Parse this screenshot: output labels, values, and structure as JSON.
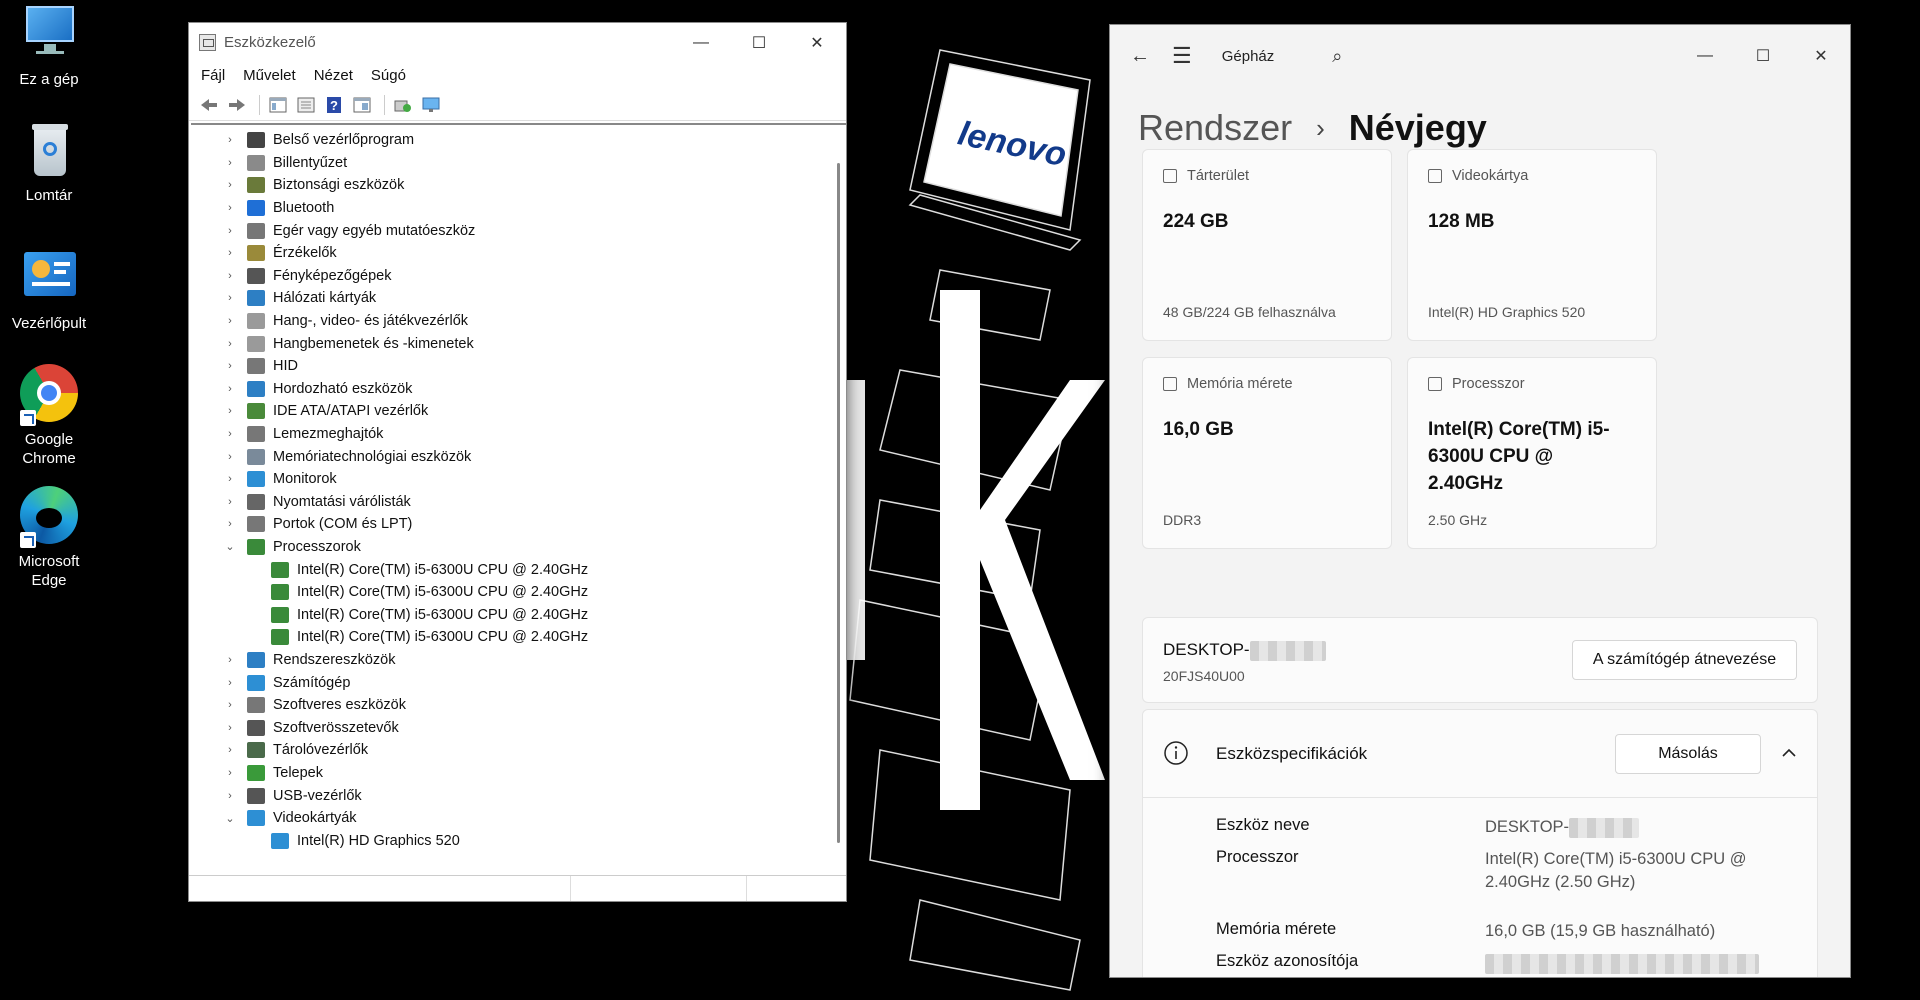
{
  "desktop": {
    "icons": [
      {
        "label": "Ez a gép",
        "icon": "monitor-icon"
      },
      {
        "label": "Lomtár",
        "icon": "recycle-bin-icon"
      },
      {
        "label": "Vezérlőpult",
        "icon": "control-panel-icon"
      },
      {
        "label_line1": "Google",
        "label_line2": "Chrome",
        "icon": "chrome-icon"
      },
      {
        "label_line1": "Microsoft",
        "label_line2": "Edge",
        "icon": "edge-icon"
      }
    ],
    "wallpaper_text": "lenovo"
  },
  "devmgr": {
    "title": "Eszközkezelő",
    "menu": [
      "Fájl",
      "Művelet",
      "Nézet",
      "Súgó"
    ],
    "tree": [
      {
        "label": "Belső vezérlőprogram",
        "expanded": false,
        "color": "#444444"
      },
      {
        "label": "Billentyűzet",
        "expanded": false,
        "color": "#8a8a8a"
      },
      {
        "label": "Biztonsági eszközök",
        "expanded": false,
        "color": "#6a7a3a"
      },
      {
        "label": "Bluetooth",
        "expanded": false,
        "color": "#1f6fd6"
      },
      {
        "label": "Egér vagy egyéb mutatóeszköz",
        "expanded": false,
        "color": "#777777"
      },
      {
        "label": "Érzékelők",
        "expanded": false,
        "color": "#9a8a3a"
      },
      {
        "label": "Fényképezőgépek",
        "expanded": false,
        "color": "#555555"
      },
      {
        "label": "Hálózati kártyák",
        "expanded": false,
        "color": "#2d7fc4"
      },
      {
        "label": "Hang-, video- és játékvezérlők",
        "expanded": false,
        "color": "#9a9a9a"
      },
      {
        "label": "Hangbemenetek és -kimenetek",
        "expanded": false,
        "color": "#9a9a9a"
      },
      {
        "label": "HID",
        "expanded": false,
        "color": "#777777"
      },
      {
        "label": "Hordozható eszközök",
        "expanded": false,
        "color": "#2d7fc4"
      },
      {
        "label": "IDE ATA/ATAPI vezérlők",
        "expanded": false,
        "color": "#4a8a3a"
      },
      {
        "label": "Lemezmeghajtók",
        "expanded": false,
        "color": "#777777"
      },
      {
        "label": "Memóriatechnológiai eszközök",
        "expanded": false,
        "color": "#7a8a9a"
      },
      {
        "label": "Monitorok",
        "expanded": false,
        "color": "#2d8fd4"
      },
      {
        "label": "Nyomtatási várólisták",
        "expanded": false,
        "color": "#666666"
      },
      {
        "label": "Portok (COM és LPT)",
        "expanded": false,
        "color": "#777777"
      },
      {
        "label": "Processzorok",
        "expanded": true,
        "color": "#3a8a3a"
      },
      {
        "label": "Intel(R) Core(TM) i5-6300U CPU @ 2.40GHz",
        "child": true,
        "color": "#3a8a3a"
      },
      {
        "label": "Intel(R) Core(TM) i5-6300U CPU @ 2.40GHz",
        "child": true,
        "color": "#3a8a3a"
      },
      {
        "label": "Intel(R) Core(TM) i5-6300U CPU @ 2.40GHz",
        "child": true,
        "color": "#3a8a3a"
      },
      {
        "label": "Intel(R) Core(TM) i5-6300U CPU @ 2.40GHz",
        "child": true,
        "color": "#3a8a3a"
      },
      {
        "label": "Rendszereszközök",
        "expanded": false,
        "color": "#2d7fc4"
      },
      {
        "label": "Számítógép",
        "expanded": false,
        "color": "#2d8fd4"
      },
      {
        "label": "Szoftveres eszközök",
        "expanded": false,
        "color": "#777777"
      },
      {
        "label": "Szoftverösszetevők",
        "expanded": false,
        "color": "#555555"
      },
      {
        "label": "Tárolóvezérlők",
        "expanded": false,
        "color": "#4a6a4a"
      },
      {
        "label": "Telepek",
        "expanded": false,
        "color": "#3a9a3a"
      },
      {
        "label": "USB-vezérlők",
        "expanded": false,
        "color": "#555555"
      },
      {
        "label": "Videokártyák",
        "expanded": true,
        "color": "#2d8fd4"
      },
      {
        "label": "Intel(R) HD Graphics 520",
        "child": true,
        "color": "#2d8fd4"
      }
    ]
  },
  "settings": {
    "app_title": "Gépház",
    "breadcrumb_parent": "Rendszer",
    "breadcrumb_current": "Névjegy",
    "cards": [
      {
        "label": "Tárterület",
        "value": "224 GB",
        "sub": "48 GB/224 GB felhasználva",
        "icon": "storage-icon"
      },
      {
        "label": "Videokártya",
        "value": "128 MB",
        "sub": "Intel(R) HD Graphics 520",
        "icon": "gpu-icon"
      },
      {
        "label": "Memória mérete",
        "value": "16,0 GB",
        "sub": "DDR3",
        "icon": "memory-icon"
      },
      {
        "label": "Processzor",
        "value": "Intel(R) Core(TM) i5-6300U CPU @ 2.40GHz",
        "sub": "2.50 GHz",
        "icon": "processor-icon"
      }
    ],
    "device": {
      "name_prefix": "DESKTOP-",
      "model": "20FJS40U00",
      "rename_button": "A számítógép átnevezése"
    },
    "specs": {
      "title": "Eszközspecifikációk",
      "copy_button": "Másolás",
      "rows": [
        {
          "label": "Eszköz neve",
          "value": "DESKTOP-"
        },
        {
          "label": "Processzor",
          "value": "Intel(R) Core(TM) i5-6300U CPU @ 2.40GHz (2.50 GHz)"
        },
        {
          "label": "Memória mérete",
          "value": "16,0 GB (15,9 GB használható)"
        },
        {
          "label": "Eszköz azonosítója",
          "value": ""
        }
      ]
    }
  }
}
